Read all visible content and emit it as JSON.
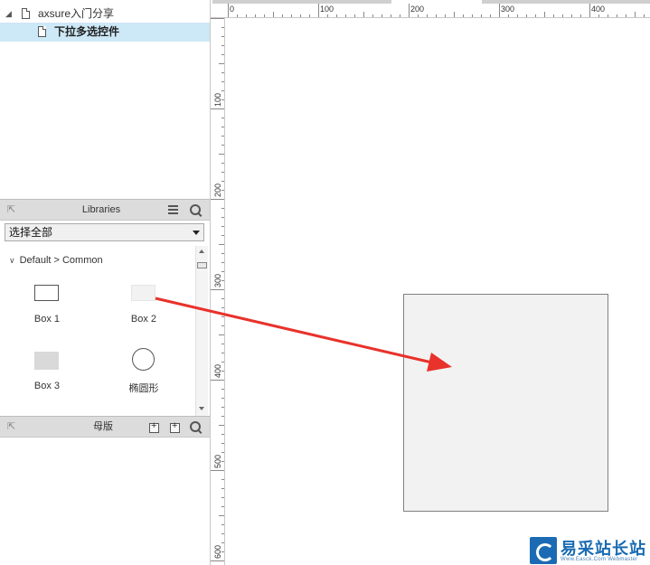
{
  "pages": {
    "root_label": "axsure入门分享",
    "child_label": "下拉多选控件"
  },
  "libraries": {
    "title": "Libraries",
    "selected_library": "选择全部",
    "group_label": "Default > Common",
    "widgets": [
      {
        "label": "Box 1",
        "icon": "box1-icon"
      },
      {
        "label": "Box 2",
        "icon": "box2-icon"
      },
      {
        "label": "Box 3",
        "icon": "box3-icon"
      },
      {
        "label": "椭圆形",
        "icon": "ellipse-icon"
      }
    ]
  },
  "masters": {
    "title": "母版"
  },
  "rulers": {
    "horizontal": [
      "0",
      "100",
      "200",
      "300",
      "400"
    ],
    "vertical": [
      "100",
      "200",
      "300",
      "400",
      "500",
      "600"
    ]
  },
  "watermark": {
    "name": "易采站长站",
    "sub": "Www.Easck.Com Webmaster"
  },
  "colors": {
    "selected_row": "#cde8f6",
    "panel_header": "#dcdcdc",
    "arrow": "#e8322b",
    "dropped_box_fill": "#f2f2f2"
  }
}
